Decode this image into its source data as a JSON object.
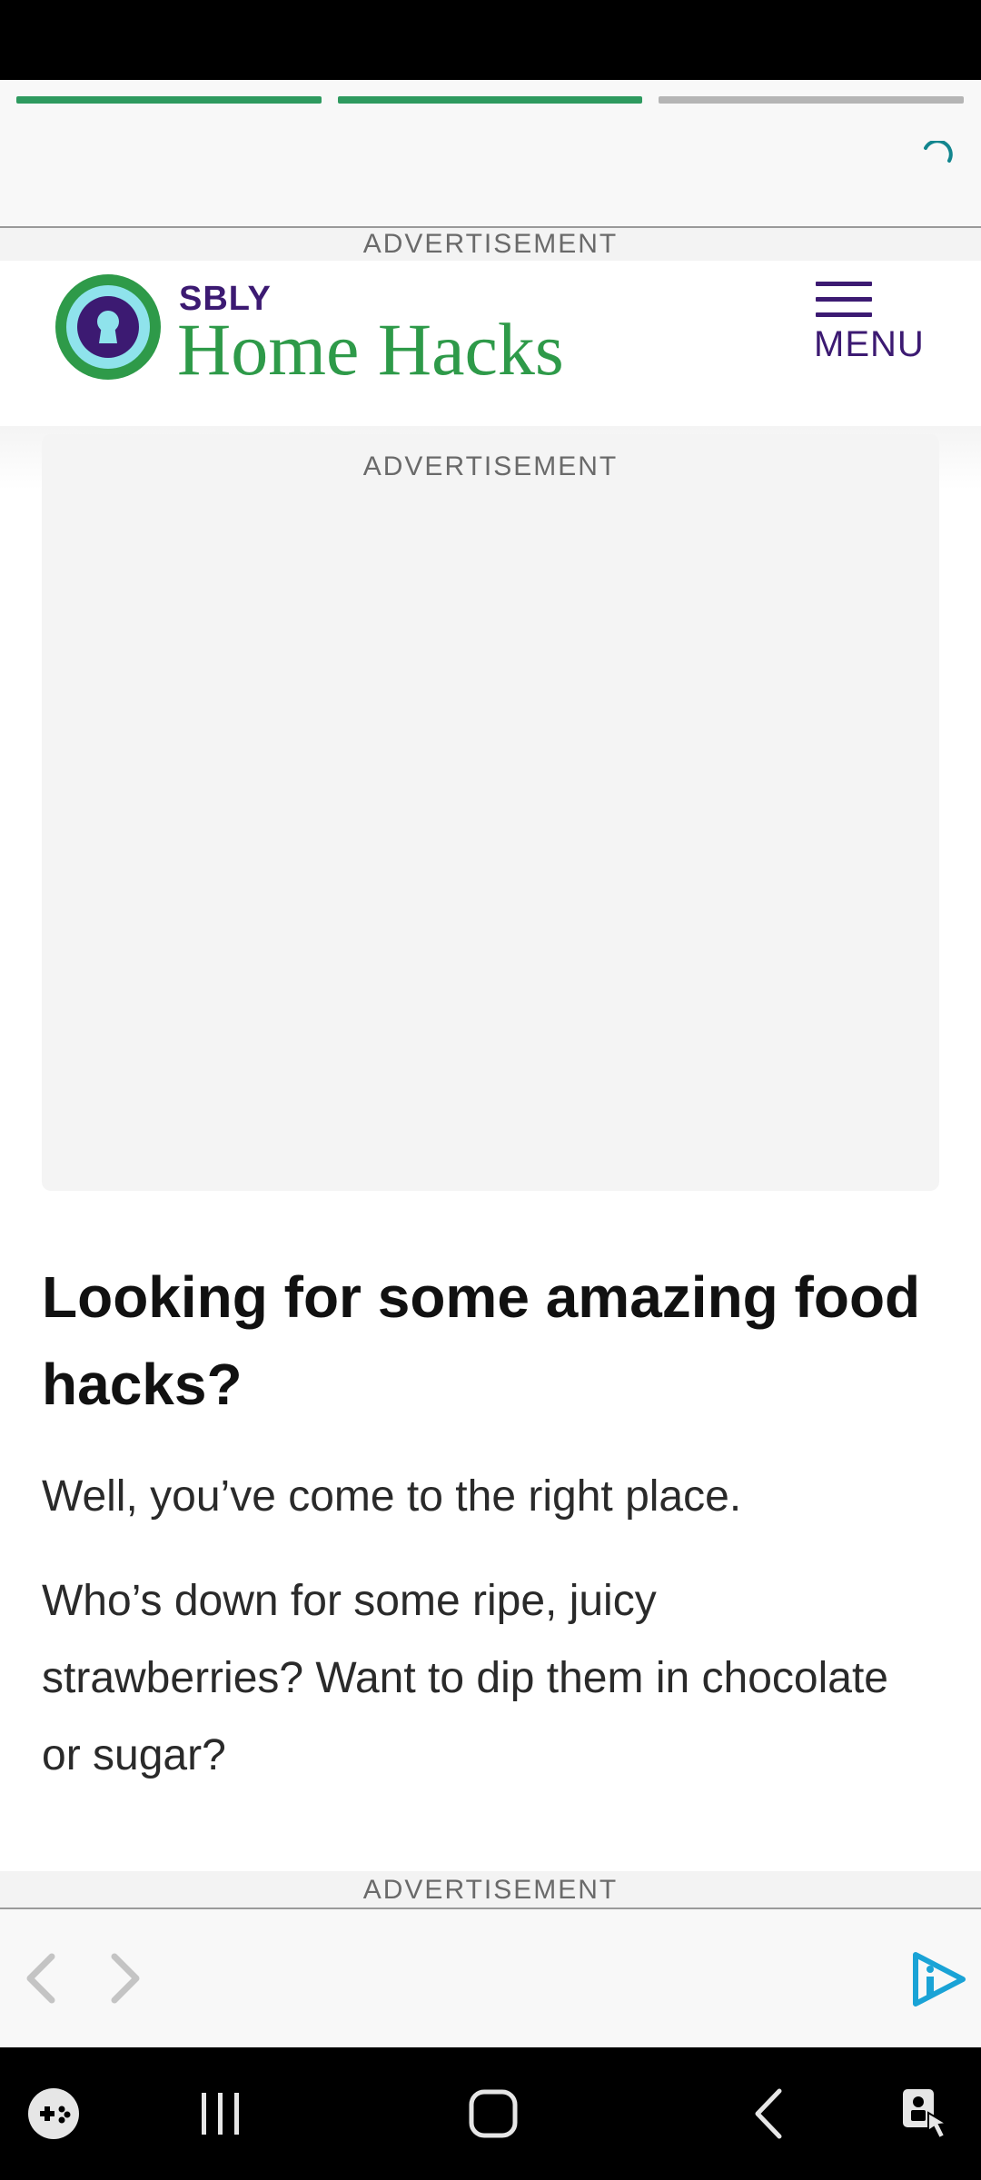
{
  "status_bar": {},
  "top_ad": {
    "progress_segments": [
      {
        "state": "complete",
        "color": "#2e9a5f"
      },
      {
        "state": "complete",
        "color": "#2e9a5f"
      },
      {
        "state": "pending",
        "color": "#b5b5b5"
      }
    ],
    "spinner_icon": "loading-spinner-icon",
    "label": "ADVERTISEMENT"
  },
  "header": {
    "logo_icon": "keyhole-icon",
    "brand_small": "SBLY",
    "brand_large": "Home Hacks",
    "menu_label": "MENU",
    "menu_icon": "hamburger-icon"
  },
  "content_ad": {
    "label": "ADVERTISEMENT"
  },
  "article": {
    "headline": "Looking for some amazing food hacks?",
    "paragraphs": [
      "Well, you’ve come to the right place.",
      "Who’s down for some ripe, juicy strawberries? Want to dip them in chocolate or sugar?"
    ]
  },
  "bottom_ad": {
    "label": "ADVERTISEMENT",
    "prev_icon": "chevron-left-icon",
    "next_icon": "chevron-right-icon",
    "adchoices_icon": "adchoices-icon"
  },
  "system_nav": {
    "items": [
      "game-launcher-icon",
      "recent-apps-icon",
      "home-icon",
      "back-icon",
      "accessibility-icon"
    ]
  },
  "colors": {
    "brand_purple": "#3c1a72",
    "brand_green": "#2e9a49",
    "logo_teal": "#8fe3ec",
    "adchoices_blue": "#1aa3d6"
  }
}
